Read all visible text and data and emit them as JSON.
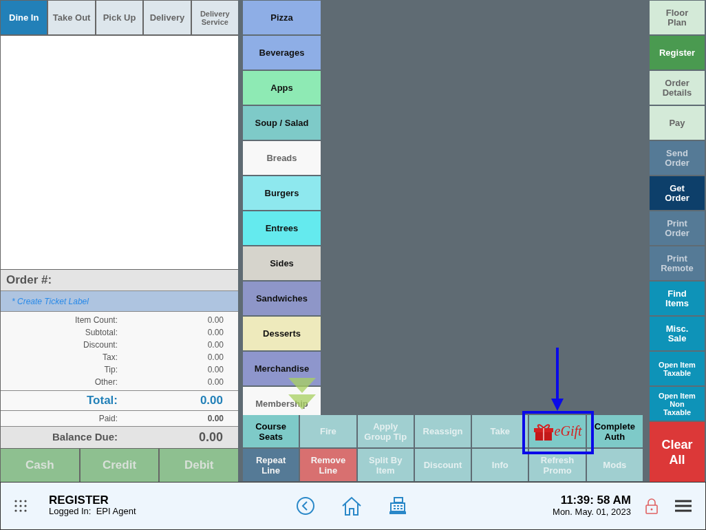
{
  "order_types": [
    {
      "label": "Dine In",
      "selected": true
    },
    {
      "label": "Take Out",
      "selected": false
    },
    {
      "label": "Pick Up",
      "selected": false
    },
    {
      "label": "Delivery",
      "selected": false
    },
    {
      "label": "Delivery Service",
      "selected": false
    }
  ],
  "order": {
    "title": "Order #:",
    "ticket_label": "* Create Ticket Label",
    "summary": [
      {
        "label": "Item Count:",
        "value": "0.00"
      },
      {
        "label": "Subtotal:",
        "value": "0.00"
      },
      {
        "label": "Discount:",
        "value": "0.00"
      },
      {
        "label": "Tax:",
        "value": "0.00"
      },
      {
        "label": "Tip:",
        "value": "0.00"
      },
      {
        "label": "Other:",
        "value": "0.00"
      }
    ],
    "total": {
      "label": "Total:",
      "value": "0.00"
    },
    "paid": {
      "label": "Paid:",
      "value": "0.00"
    },
    "balance": {
      "label": "Balance Due:",
      "value": "0.00"
    }
  },
  "payment_buttons": [
    {
      "label": "Cash",
      "disabled": true
    },
    {
      "label": "Credit",
      "disabled": true
    },
    {
      "label": "Debit",
      "disabled": true
    }
  ],
  "categories": [
    {
      "label": "Pizza",
      "color": "#8eaee6"
    },
    {
      "label": "Beverages",
      "color": "#8eaee6"
    },
    {
      "label": "Apps",
      "color": "#8eeab4"
    },
    {
      "label": "Soup / Salad",
      "color": "#7ecac8"
    },
    {
      "label": "Breads",
      "color": "#f8f8f8"
    },
    {
      "label": "Burgers",
      "color": "#8ee8ee"
    },
    {
      "label": "Entrees",
      "color": "#64eaee"
    },
    {
      "label": "Sides",
      "color": "#d6d4cc"
    },
    {
      "label": "Sandwiches",
      "color": "#8e96c8"
    },
    {
      "label": "Desserts",
      "color": "#eeeabc"
    },
    {
      "label": "Merchandise",
      "color": "#8e96cc"
    },
    {
      "label": "Membership",
      "color": "#f8f8f8"
    }
  ],
  "actions": [
    {
      "kind": "text",
      "label": "Course Seats",
      "color": "#7ecac8",
      "disabled": false
    },
    {
      "kind": "text",
      "label": "Fire",
      "color": "#a0cfd0",
      "disabled": true
    },
    {
      "kind": "text",
      "label": "Apply Group Tip",
      "color": "#a0cfd0",
      "disabled": true
    },
    {
      "kind": "text",
      "label": "Reassign",
      "color": "#a0cfd0",
      "disabled": true
    },
    {
      "kind": "text",
      "label": "Take",
      "color": "#a0cfd0",
      "disabled": true
    },
    {
      "kind": "egift",
      "label": "eGift",
      "color": "#7ecac8",
      "disabled": false
    },
    {
      "kind": "text",
      "label": "Complete Auth",
      "color": "#7ecac8",
      "disabled": false
    },
    {
      "kind": "text",
      "label": "Repeat Line",
      "color": "#557a96",
      "disabled": false
    },
    {
      "kind": "text",
      "label": "Remove Line",
      "color": "#d87070",
      "disabled": false
    },
    {
      "kind": "text",
      "label": "Split By Item",
      "color": "#a0cfd0",
      "disabled": true
    },
    {
      "kind": "text",
      "label": "Discount",
      "color": "#a0cfd0",
      "disabled": true
    },
    {
      "kind": "text",
      "label": "Info",
      "color": "#a0cfd0",
      "disabled": true
    },
    {
      "kind": "text",
      "label": "Refresh Promo",
      "color": "#a0cfd0",
      "disabled": true
    },
    {
      "kind": "text",
      "label": "Mods",
      "color": "#a0cfd0",
      "disabled": true
    }
  ],
  "side_buttons": [
    {
      "label": "Floor Plan",
      "color": "#d4ead8",
      "kind": "normal",
      "disabled": true
    },
    {
      "label": "Register",
      "color": "#4a9a50",
      "kind": "normal",
      "disabled": false
    },
    {
      "label": "Order Details",
      "color": "#d4ead8",
      "kind": "normal",
      "disabled": true
    },
    {
      "label": "Pay",
      "color": "#d4ead8",
      "kind": "normal",
      "disabled": true
    },
    {
      "label": "Send Order",
      "color": "#557a96",
      "kind": "normal",
      "disabled": true
    },
    {
      "label": "Get Order",
      "color": "#0d3f6a",
      "kind": "normal",
      "disabled": false
    },
    {
      "label": "Print Order",
      "color": "#557a96",
      "kind": "normal",
      "disabled": true
    },
    {
      "label": "Print Remote",
      "color": "#557a96",
      "kind": "normal",
      "disabled": true
    },
    {
      "label": "Find Items",
      "color": "#0e93b8",
      "kind": "normal",
      "disabled": false
    },
    {
      "label": "Misc. Sale",
      "color": "#0e93b8",
      "kind": "normal",
      "disabled": false
    },
    {
      "label": "Open Item Taxable",
      "color": "#0e93b8",
      "kind": "small",
      "disabled": false
    },
    {
      "label": "Open Item Non Taxable",
      "color": "#0e93b8",
      "kind": "small",
      "disabled": false
    },
    {
      "label": "Clear All",
      "color": "#dc3838",
      "kind": "large",
      "disabled": false
    }
  ],
  "footer": {
    "title": "REGISTER",
    "logged_in": "Logged In:  EPI Agent",
    "time": "11:39: 58 AM",
    "date": "Mon. May. 01, 2023"
  }
}
